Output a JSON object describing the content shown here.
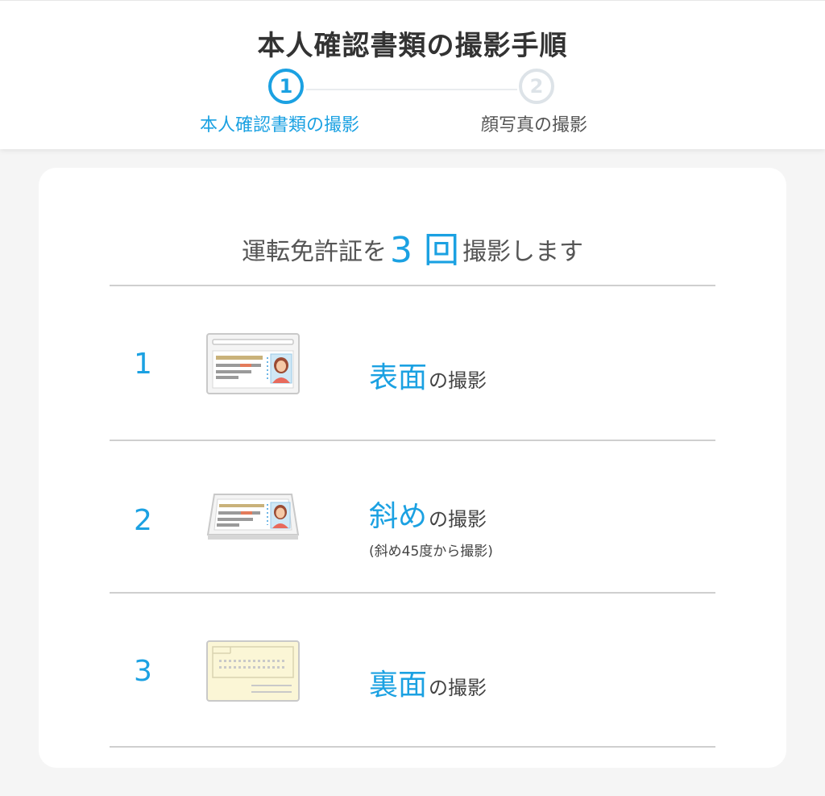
{
  "header": {
    "title": "本人確認書類の撮影手順",
    "steps": [
      {
        "number": "1",
        "label": "本人確認書類の撮影",
        "state": "active"
      },
      {
        "number": "2",
        "label": "顔写真の撮影",
        "state": "inactive"
      }
    ]
  },
  "card": {
    "heading_pre": "運転免許証を",
    "count": "3",
    "count_unit": "回",
    "heading_post": "撮影します",
    "items": [
      {
        "number": "1",
        "highlight": "表面",
        "suffix": "の撮影",
        "note": "",
        "icon": "license-front-icon"
      },
      {
        "number": "2",
        "highlight": "斜め",
        "suffix": "の撮影",
        "note": "(斜め45度から撮影)",
        "icon": "license-tilted-icon"
      },
      {
        "number": "3",
        "highlight": "裏面",
        "suffix": "の撮影",
        "note": "",
        "icon": "license-back-icon"
      }
    ]
  },
  "colors": {
    "accent": "#1ba1e2",
    "inactive_step": "#dde3e8",
    "background": "#f5f5f5",
    "card": "#ffffff"
  }
}
